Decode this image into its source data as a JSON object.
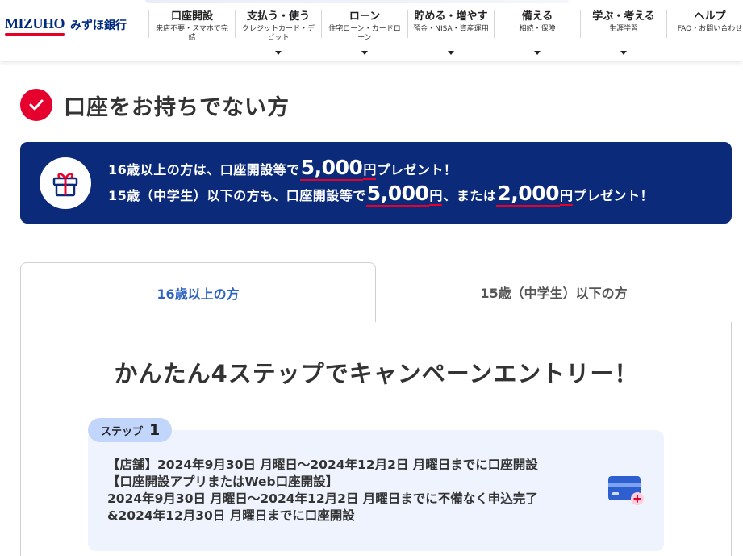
{
  "header": {
    "logo_en": "MIZUHO",
    "logo_ja": "みずほ銀行",
    "nav": [
      {
        "title": "口座開設",
        "sub": "来店不要・スマホで完結",
        "arrow": false
      },
      {
        "title": "支払う・使う",
        "sub": "クレジットカード・デビット",
        "arrow": true
      },
      {
        "title": "ローン",
        "sub": "住宅ローン・カードローン",
        "arrow": true
      },
      {
        "title": "貯める・増やす",
        "sub": "預金・NISA・資産運用",
        "arrow": true
      },
      {
        "title": "備える",
        "sub": "相続・保険",
        "arrow": true
      },
      {
        "title": "学ぶ・考える",
        "sub": "生涯学習",
        "arrow": true
      },
      {
        "title": "ヘルプ",
        "sub": "FAQ・お問い合わせ",
        "arrow": false
      }
    ]
  },
  "page": {
    "heading": "口座をお持ちでない方"
  },
  "banner": {
    "line1": {
      "pre": "16歳以上の方は、口座開設等で",
      "amount": "5,000",
      "unit": "円",
      "post": "プレゼント！"
    },
    "line2": {
      "pre": "15歳（中学生）以下の方も、口座開設等で",
      "amount1": "5,000",
      "unit1": "円",
      "mid": "、または",
      "amount2": "2,000",
      "unit2": "円",
      "post": "プレゼント！"
    }
  },
  "tabs": [
    {
      "label": "16歳以上の方",
      "active": true
    },
    {
      "label": "15歳（中学生）以下の方",
      "active": false
    }
  ],
  "content": {
    "steps_title": "かんたん4ステップでキャンペーンエントリー！",
    "step": {
      "badge_label": "ステップ",
      "badge_number": "1",
      "lines": [
        "【店舗】2024年9月30日 月曜日～2024年12月2日 月曜日までに口座開設",
        "【口座開設アプリまたはWeb口座開設】",
        "2024年9月30日 月曜日～2024年12月2日 月曜日までに不備なく申込完了",
        "&2024年12月30日 月曜日までに口座開設"
      ]
    }
  },
  "colors": {
    "brand_navy": "#0b2a7a",
    "accent_red": "#e6002d",
    "tab_active_text": "#2d62c3",
    "step_card_bg": "#eef3fd",
    "step_badge_bg": "#c2d5fa"
  },
  "icons": {
    "heading": "check-circle-icon",
    "banner": "gift-icon",
    "step": "credit-card-plus-icon",
    "nav_arrow": "caret-down-icon"
  }
}
